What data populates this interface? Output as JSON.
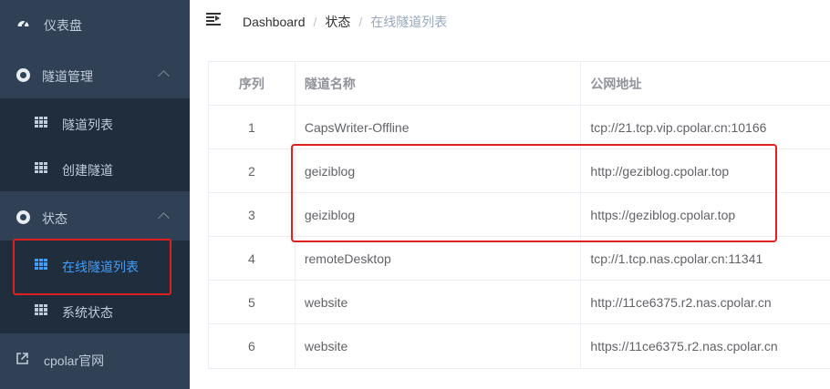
{
  "sidebar": {
    "dashboard": {
      "label": "仪表盘",
      "icon": "dashboard-icon"
    },
    "tunnel_management": {
      "label": "隧道管理",
      "icon": "circle-icon",
      "items": [
        {
          "label": "隧道列表",
          "icon": "grid-icon"
        },
        {
          "label": "创建隧道",
          "icon": "grid-icon"
        }
      ]
    },
    "status": {
      "label": "状态",
      "icon": "circle-icon",
      "items": [
        {
          "label": "在线隧道列表",
          "icon": "grid-icon",
          "active": true
        },
        {
          "label": "系统状态",
          "icon": "grid-icon"
        }
      ]
    },
    "website": {
      "label": "cpolar官网",
      "icon": "external-link-icon"
    }
  },
  "header": {
    "breadcrumb": [
      "Dashboard",
      "状态",
      "在线隧道列表"
    ]
  },
  "table": {
    "columns": [
      "序列",
      "隧道名称",
      "公网地址"
    ],
    "rows": [
      [
        "1",
        "CapsWriter-Offline",
        "tcp://21.tcp.vip.cpolar.cn:10166"
      ],
      [
        "2",
        "geiziblog",
        "http://geziblog.cpolar.top"
      ],
      [
        "3",
        "geiziblog",
        "https://geziblog.cpolar.top"
      ],
      [
        "4",
        "remoteDesktop",
        "tcp://1.tcp.nas.cpolar.cn:11341"
      ],
      [
        "5",
        "website",
        "http://11ce6375.r2.nas.cpolar.cn"
      ],
      [
        "6",
        "website",
        "https://11ce6375.r2.nas.cpolar.cn"
      ]
    ]
  },
  "colors": {
    "sidebar_bg": "#304156",
    "submenu_bg": "#1f2d3d",
    "active": "#409eff",
    "annotation": "#e02020"
  }
}
